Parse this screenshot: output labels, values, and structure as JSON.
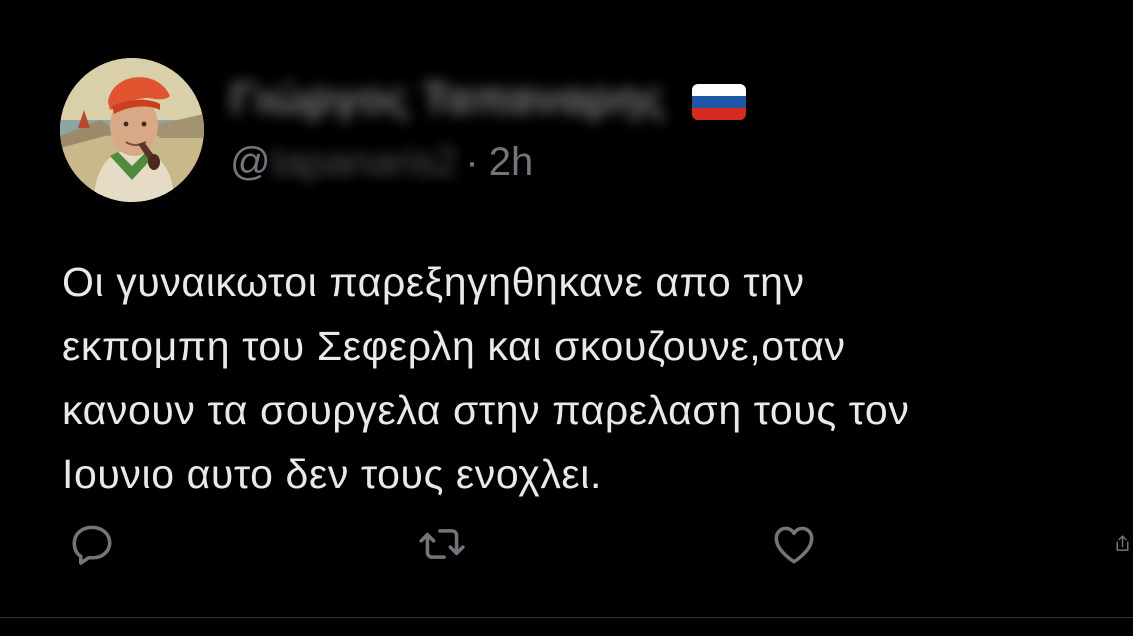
{
  "tweet": {
    "display_name": "Γιώργος Ταπαναρης",
    "handle_prefix": "@",
    "handle_name": "tapanaris2",
    "separator": "·",
    "time": "2h",
    "flag_icon": "russia-flag-icon",
    "body_lines": [
      "Οι γυναικωτοι παρεξηγηθηκανε απο την",
      "εκπομπη του Σεφερλη και σκουζουνε,οταν",
      "κανουν τα σουργελα στην παρελαση τους τον",
      "Ιουνιο αυτο δεν τους ενοχλει."
    ]
  },
  "actions": {
    "reply_icon": "reply-icon",
    "retweet_icon": "retweet-icon",
    "like_icon": "heart-icon",
    "share_icon": "share-icon"
  },
  "colors": {
    "background": "#000000",
    "text_primary": "#e7e9ea",
    "text_secondary": "#71767b",
    "divider": "#2f3336"
  }
}
